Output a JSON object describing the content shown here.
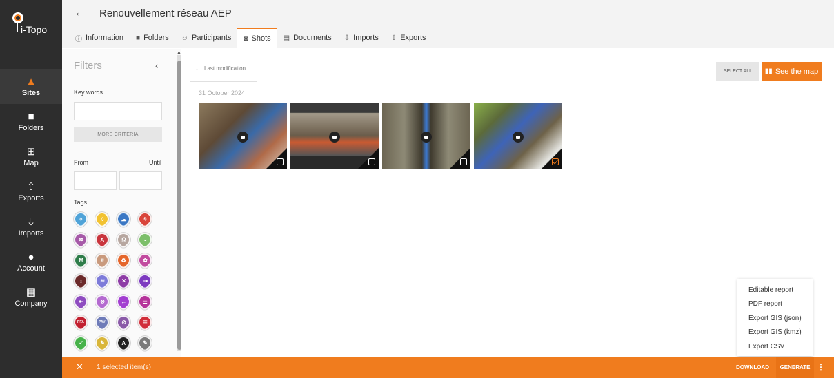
{
  "app": {
    "logo_text": "i-Topo"
  },
  "sidebar": {
    "items": [
      {
        "label": "Sites",
        "icon": "cone-icon",
        "glyph": "▲"
      },
      {
        "label": "Folders",
        "icon": "folder-icon",
        "glyph": "■"
      },
      {
        "label": "Map",
        "icon": "map-icon",
        "glyph": "⊞"
      },
      {
        "label": "Exports",
        "icon": "upload-icon",
        "glyph": "⇧"
      },
      {
        "label": "Imports",
        "icon": "download-icon",
        "glyph": "⇩"
      },
      {
        "label": "Account",
        "icon": "user-icon",
        "glyph": "●"
      },
      {
        "label": "Company",
        "icon": "building-icon",
        "glyph": "▦"
      }
    ]
  },
  "header": {
    "title": "Renouvellement réseau AEP",
    "tabs": [
      {
        "label": "Information",
        "icon": "info-icon",
        "glyph": "ⓘ"
      },
      {
        "label": "Folders",
        "icon": "folder-icon",
        "glyph": "■"
      },
      {
        "label": "Participants",
        "icon": "users-icon",
        "glyph": "☺"
      },
      {
        "label": "Shots",
        "icon": "camera-icon",
        "glyph": "◙"
      },
      {
        "label": "Documents",
        "icon": "document-icon",
        "glyph": "▤"
      },
      {
        "label": "Imports",
        "icon": "download-icon",
        "glyph": "⇩"
      },
      {
        "label": "Exports",
        "icon": "upload-icon",
        "glyph": "⇧"
      }
    ]
  },
  "filters": {
    "title": "Filters",
    "keywords_label": "Key words",
    "keywords_value": "",
    "more_criteria": "MORE CRITERIA",
    "from_label": "From",
    "until_label": "Until",
    "from_value": "",
    "until_value": "",
    "tags_label": "Tags",
    "tags": [
      {
        "color": "#4fa3d8",
        "glyph": "◊"
      },
      {
        "color": "#f2c230",
        "glyph": "◊"
      },
      {
        "color": "#3b78c4",
        "glyph": "☁"
      },
      {
        "color": "#d9453b",
        "glyph": "ϟ"
      },
      {
        "color": "#a65aa8",
        "glyph": "≋"
      },
      {
        "color": "#c9353d",
        "glyph": "A"
      },
      {
        "color": "#b7a7a0",
        "glyph": "Ω"
      },
      {
        "color": "#7cbf6a",
        "glyph": "◒"
      },
      {
        "color": "#2f7d4a",
        "glyph": "M"
      },
      {
        "color": "#c99a7d",
        "glyph": "#"
      },
      {
        "color": "#e5662b",
        "glyph": "♻"
      },
      {
        "color": "#c24a9f",
        "glyph": "✿"
      },
      {
        "color": "#6b2a2a",
        "glyph": "♁"
      },
      {
        "color": "#7d7bd9",
        "glyph": "≋"
      },
      {
        "color": "#8e3ca6",
        "glyph": "✕"
      },
      {
        "color": "#7d3ac0",
        "glyph": "⇥"
      },
      {
        "color": "#8e4cc0",
        "glyph": "⇤"
      },
      {
        "color": "#b46ad0",
        "glyph": "⊗"
      },
      {
        "color": "#a23ed1",
        "glyph": "←"
      },
      {
        "color": "#b5339a",
        "glyph": "☰"
      },
      {
        "color": "#c22030",
        "glyph": "RTA"
      },
      {
        "color": "#6e7bb8",
        "glyph": "PAV"
      },
      {
        "color": "#8a5aa8",
        "glyph": "⊘"
      },
      {
        "color": "#d12e3a",
        "glyph": "≣"
      },
      {
        "color": "#47b24a",
        "glyph": "✓"
      },
      {
        "color": "#d9b63a",
        "glyph": "✎"
      },
      {
        "color": "#222222",
        "glyph": "A"
      },
      {
        "color": "#7b7b7b",
        "glyph": "✎"
      }
    ]
  },
  "main": {
    "sort_label": "Last modification",
    "date_group": "31 October 2024",
    "select_all": "SELECT ALL",
    "see_map": "See the map",
    "photos": [
      {
        "selected": false,
        "bg": "linear-gradient(135deg,#8c7a5e 0%,#5e4a36 35%,#3a6aa8 55%,#b06a48 75%,#d7d0c4 100%)"
      },
      {
        "selected": false,
        "bg": "linear-gradient(180deg,#3a3a3a 0%,#3a3a3a 15%,#a39a8a 16%,#6a5c4a 50%,#c95a32 60%,#555 80%,#2a2a2a 81%)"
      },
      {
        "selected": false,
        "bg": "linear-gradient(90deg,#6c6552 0%,#8e8a76 25%,#3f3a2e 45%,#3c7ad4 50%,#3f3a2e 55%,#8e8a76 75%,#6c6552 100%)"
      },
      {
        "selected": true,
        "bg": "linear-gradient(135deg,#8ab04a 0%,#5c6a3a 25%,#3e64b8 45%,#6e6248 65%,#e4e4e0 85%,#8a8a7a 100%)"
      }
    ]
  },
  "menu": {
    "items": [
      "Editable report",
      "PDF report",
      "Export GIS (json)",
      "Export GIS (kmz)",
      "Export CSV"
    ]
  },
  "bottombar": {
    "count_text": "1 selected item(s)",
    "download": "DOWNLOAD",
    "generate": "GENERATE"
  },
  "colors": {
    "accent": "#f07c1e",
    "sidebar": "#2d2d2d"
  }
}
